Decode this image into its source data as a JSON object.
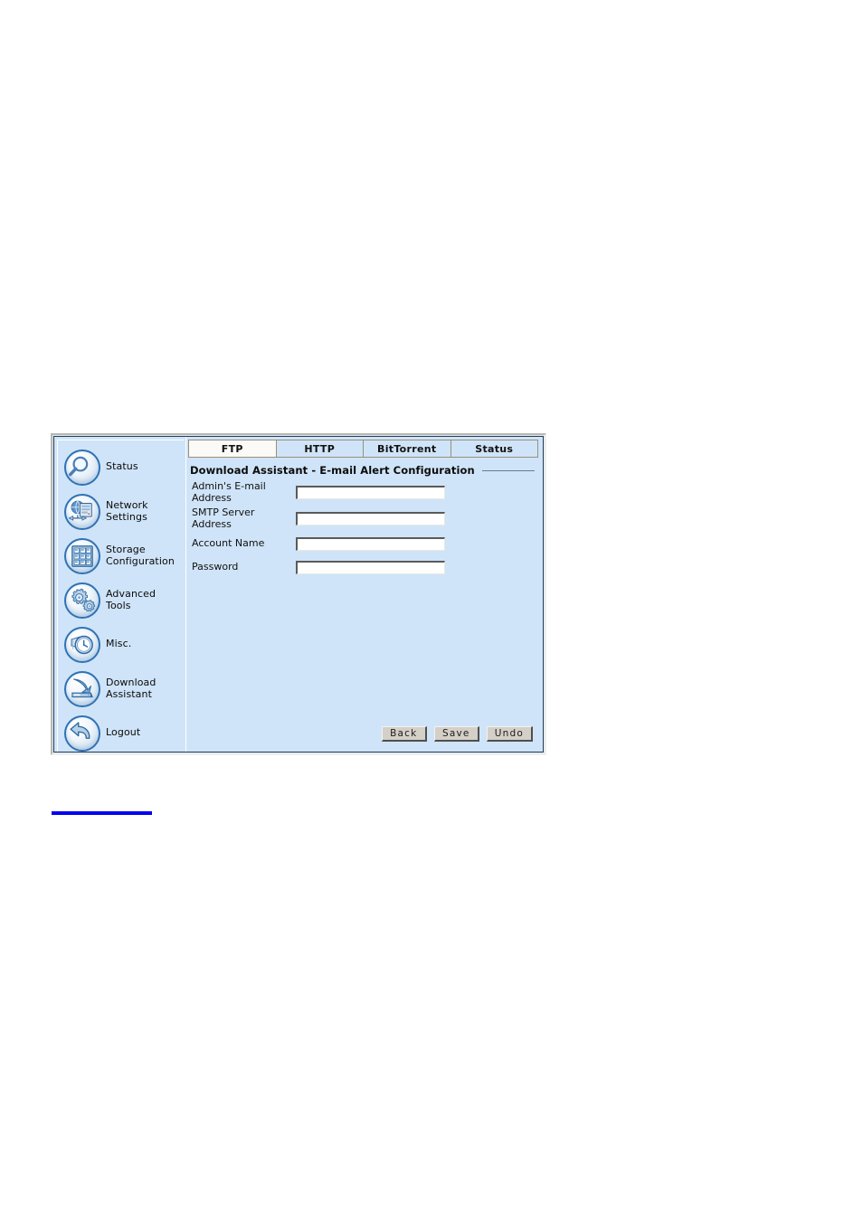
{
  "window": {
    "accent_blue": "#2f72b5",
    "panel_bg": "#cfe4f8",
    "active_tab_bg": "#fbfaf6"
  },
  "sidebar": {
    "items": [
      {
        "label": "Status",
        "icon": "magnifier-icon"
      },
      {
        "label": "Network\nSettings",
        "icon": "network-globe-server-icon"
      },
      {
        "label": "Storage\nConfiguration",
        "icon": "disk-grid-icon"
      },
      {
        "label": "Advanced\nTools",
        "icon": "gears-icon"
      },
      {
        "label": "Misc.",
        "icon": "clock-icon"
      },
      {
        "label": "Download\nAssistant",
        "icon": "download-tray-icon"
      },
      {
        "label": "Logout",
        "icon": "back-arrow-icon"
      }
    ]
  },
  "tabs": [
    {
      "label": "FTP",
      "active": true
    },
    {
      "label": "HTTP",
      "active": false
    },
    {
      "label": "BitTorrent",
      "active": false
    },
    {
      "label": "Status",
      "active": false
    }
  ],
  "section": {
    "title": "Download Assistant - E-mail Alert Configuration"
  },
  "form": {
    "fields": [
      {
        "label": "Admin's E-mail\nAddress",
        "value": "",
        "placeholder": "",
        "type": "text"
      },
      {
        "label": "SMTP Server\nAddress",
        "value": "",
        "placeholder": "",
        "type": "text"
      },
      {
        "label": "Account Name",
        "value": "",
        "placeholder": "",
        "type": "text"
      },
      {
        "label": "Password",
        "value": "",
        "placeholder": "",
        "type": "password"
      }
    ]
  },
  "buttons": [
    {
      "label": "Back"
    },
    {
      "label": "Save"
    },
    {
      "label": "Undo"
    }
  ]
}
